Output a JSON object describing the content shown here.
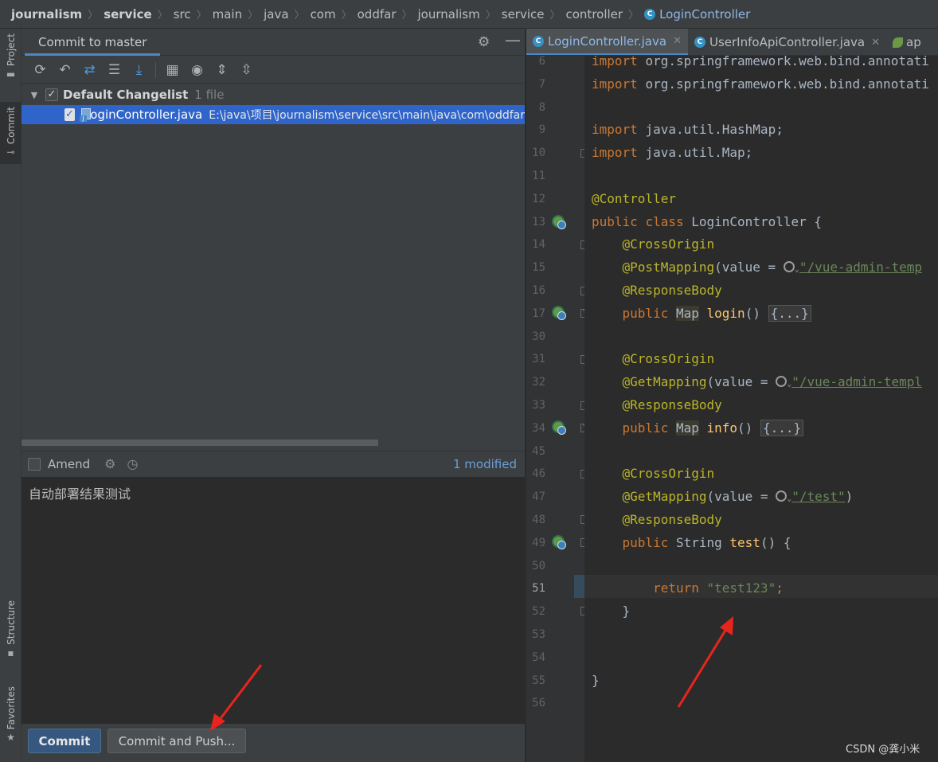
{
  "breadcrumb": {
    "items": [
      "journalism",
      "service",
      "src",
      "main",
      "java",
      "com",
      "oddfar",
      "journalism",
      "service",
      "controller",
      "LoginController"
    ],
    "class_icon": "C"
  },
  "toolstrip": {
    "project": "Project",
    "commit": "Commit",
    "structure": "Structure",
    "favorites": "Favorites"
  },
  "commit_panel": {
    "title": "Commit to master",
    "toolbar_icons": [
      "refresh-icon",
      "rollback-icon",
      "diff-icon",
      "shelve-icon",
      "update-icon",
      "group-by-icon",
      "eye-icon",
      "expand-all-icon",
      "collapse-all-icon"
    ],
    "changelist": {
      "name": "Default Changelist",
      "count": "1 file",
      "files": [
        {
          "name": "LoginController.java",
          "path": "E:\\java\\项目\\journalism\\service\\src\\main\\java\\com\\oddfar"
        }
      ]
    },
    "amend_label": "Amend",
    "modified_count": "1 modified",
    "message": "自动部署结果测试",
    "commit_button": "Commit",
    "commit_push_button": "Commit and Push..."
  },
  "editor": {
    "tabs": [
      {
        "label": "LoginController.java",
        "active": true
      },
      {
        "label": "UserInfoApiController.java",
        "active": false
      },
      {
        "label": "ap",
        "active": false
      }
    ],
    "current_line": "51",
    "lines": [
      {
        "n": "6",
        "code": "import org.springframework.web.bind.annotation.RequestMapping;"
      },
      {
        "n": "7",
        "code": "import org.springframework.web.bind.annotation.ResponseBody;"
      },
      {
        "n": "8",
        "code": ""
      },
      {
        "n": "9",
        "code": "import java.util.HashMap;"
      },
      {
        "n": "10",
        "code": "import java.util.Map;"
      },
      {
        "n": "11",
        "code": ""
      },
      {
        "n": "12",
        "code": "@Controller"
      },
      {
        "n": "13",
        "code": "public class LoginController {"
      },
      {
        "n": "14",
        "code": "    @CrossOrigin"
      },
      {
        "n": "15",
        "code": "    @PostMapping(value = \"/vue-admin-template/user/login\")"
      },
      {
        "n": "16",
        "code": "    @ResponseBody"
      },
      {
        "n": "17",
        "code": "    public Map login() {...}"
      },
      {
        "n": "30",
        "code": ""
      },
      {
        "n": "31",
        "code": "    @CrossOrigin"
      },
      {
        "n": "32",
        "code": "    @GetMapping(value = \"/vue-admin-template/user/info\")"
      },
      {
        "n": "33",
        "code": "    @ResponseBody"
      },
      {
        "n": "34",
        "code": "    public Map info() {...}"
      },
      {
        "n": "45",
        "code": ""
      },
      {
        "n": "46",
        "code": "    @CrossOrigin"
      },
      {
        "n": "47",
        "code": "    @GetMapping(value = \"/test\")"
      },
      {
        "n": "48",
        "code": "    @ResponseBody"
      },
      {
        "n": "49",
        "code": "    public String test() {"
      },
      {
        "n": "50",
        "code": ""
      },
      {
        "n": "51",
        "code": "        return \"test123\";"
      },
      {
        "n": "52",
        "code": "    }"
      },
      {
        "n": "53",
        "code": ""
      },
      {
        "n": "54",
        "code": ""
      },
      {
        "n": "55",
        "code": "}"
      },
      {
        "n": "56",
        "code": ""
      }
    ],
    "tokens": {
      "import": "import",
      "imp6": "org.springframework.web.bind.annotati",
      "imp7": "org.springframework.web.bind.annotati",
      "imp9": "java.util.HashMap;",
      "imp10": "java.util.Map;",
      "controller": "@Controller",
      "public": "public",
      "class": "class",
      "class_name": "LoginController {",
      "crossorigin": "@CrossOrigin",
      "postmapping": "@PostMapping",
      "getmapping": "@GetMapping",
      "value_eq": "(value = ",
      "url_login": "\"/vue-admin-temp",
      "url_info": "\"/vue-admin-templ",
      "url_test": "\"/test\"",
      "close_paren": ")",
      "responsebody": "@ResponseBody",
      "map": "Map",
      "string": "String",
      "login": "login",
      "info": "info",
      "test": "test",
      "parens": "() ",
      "parens_brace": "() {",
      "folded": "{...}",
      "return": "return",
      "test_str": "\"test123\"",
      "semicolon": ";",
      "close_brace": "}"
    }
  },
  "watermark": "CSDN @龚小米"
}
